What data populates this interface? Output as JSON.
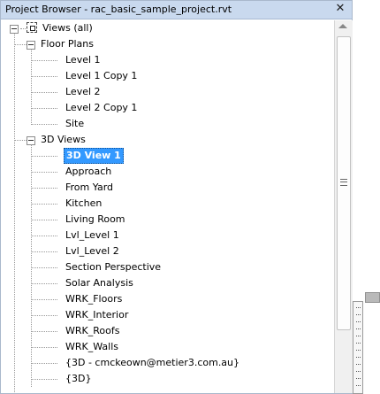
{
  "window": {
    "title": "Project Browser - rac_basic_sample_project.rvt",
    "close_glyph": "✕"
  },
  "tree": {
    "root_label": "Views (all)",
    "floor_plans": {
      "label": "Floor Plans",
      "items": [
        "Level 1",
        "Level 1 Copy 1",
        "Level 2",
        "Level 2 Copy 1",
        "Site"
      ]
    },
    "three_d_views": {
      "label": "3D Views",
      "selected": "3D View 1",
      "items": [
        "3D View 1",
        "Approach",
        "From Yard",
        "Kitchen",
        "Living Room",
        "Lvl_Level 1",
        "Lvl_Level 2",
        "Section Perspective",
        "Solar Analysis",
        "WRK_Floors",
        "WRK_Interior",
        "WRK_Roofs",
        "WRK_Walls",
        "{3D - cmckeown@metier3.com.au}",
        "{3D}"
      ]
    }
  },
  "icons": {
    "views_root": "view-all-icon",
    "collapse": "minus-toggle-icon",
    "close": "close-icon",
    "scroll_up": "scroll-up-arrow-icon",
    "scroll_grip": "scroll-grip-icon"
  },
  "colors": {
    "titlebar_bg": "#c9d9ee",
    "selection_bg": "#3399ff",
    "selection_text": "#ffffff"
  }
}
